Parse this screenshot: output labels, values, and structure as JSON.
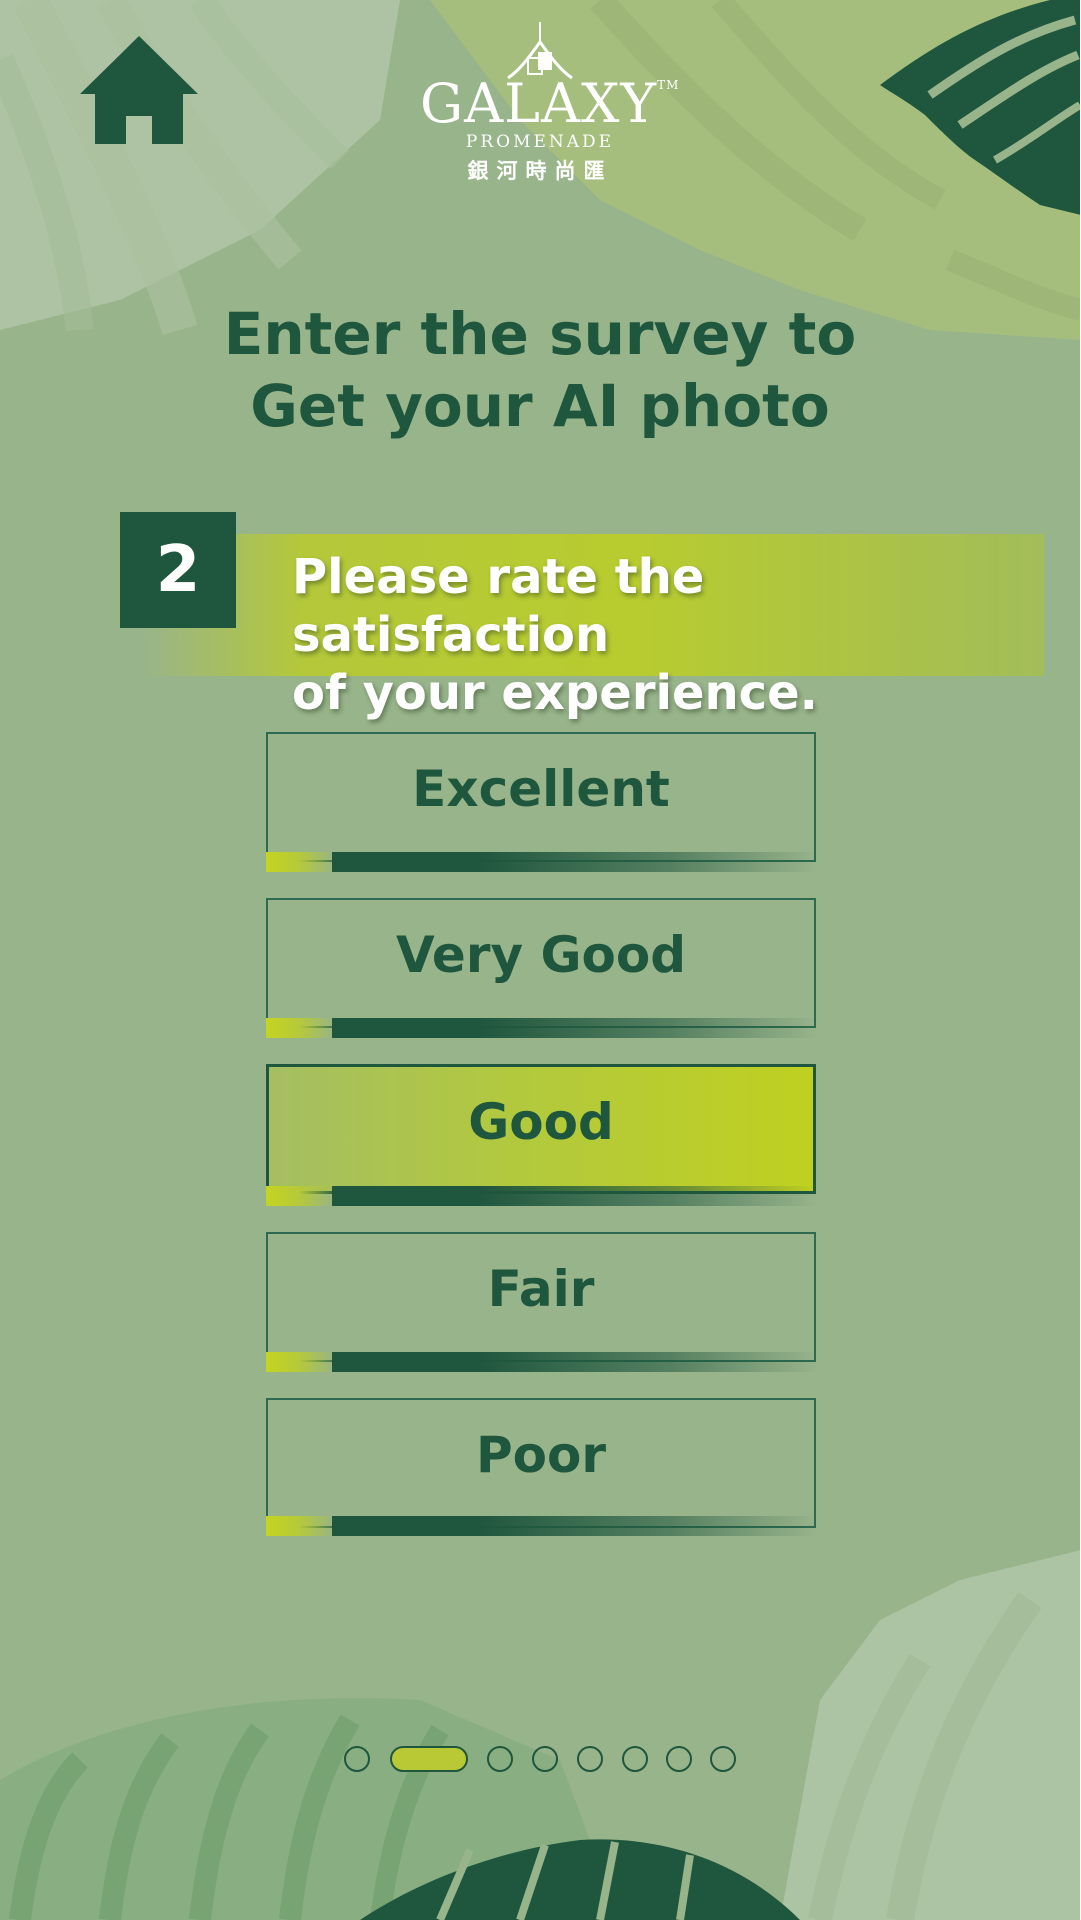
{
  "brand": {
    "name": "GALAXY",
    "trademark": "TM",
    "subtitle": "PROMENADE",
    "chinese": "銀河時尚匯"
  },
  "heading": {
    "line1": "Enter the survey to",
    "line2": "Get your AI photo"
  },
  "question": {
    "number": "2",
    "line1": "Please rate the satisfaction",
    "line2": "of your experience."
  },
  "options": [
    {
      "label": "Excellent",
      "selected": false
    },
    {
      "label": "Very Good",
      "selected": false
    },
    {
      "label": "Good",
      "selected": true
    },
    {
      "label": "Fair",
      "selected": false
    },
    {
      "label": "Poor",
      "selected": false
    }
  ],
  "pagination": {
    "total": 8,
    "current": 2
  },
  "icons": {
    "home": "home-icon",
    "logo": "galaxy-promenade-logo"
  },
  "colors": {
    "background": "#98b48b",
    "dark_green": "#1f563e",
    "lime": "#b8cc2f",
    "white": "#ffffff"
  }
}
